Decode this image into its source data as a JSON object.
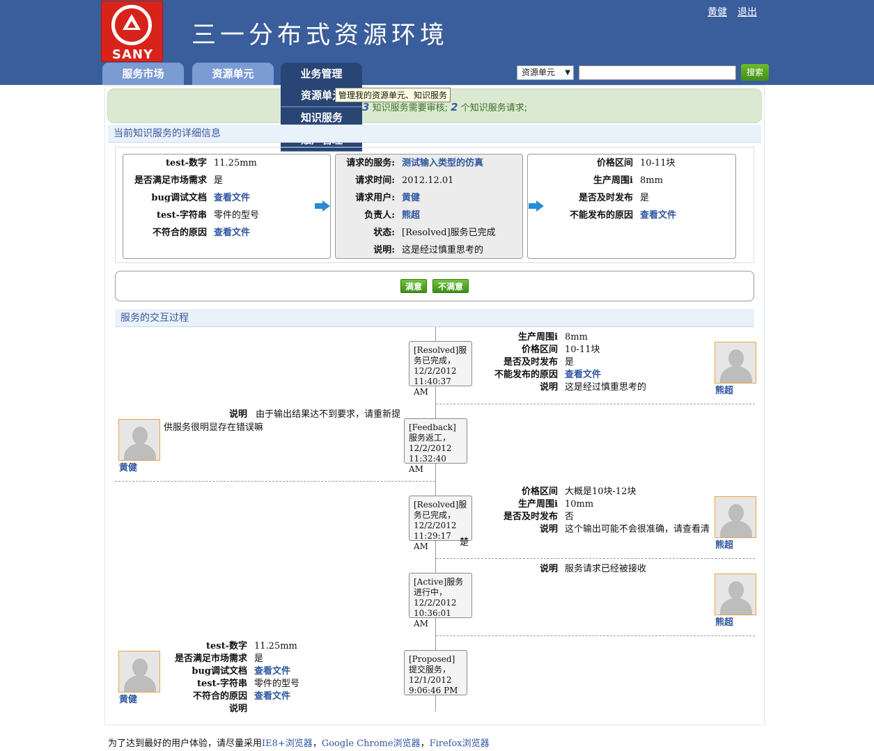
{
  "header": {
    "title": "三一分布式资源环境",
    "logo_text": "SANY",
    "user_link": "黄健",
    "logout_link": "退出"
  },
  "nav": {
    "tabs": [
      "服务市场",
      "资源单元",
      "业务管理"
    ],
    "dropdown": [
      "资源单元",
      "知识服务",
      "账户管理"
    ],
    "tooltip": "管理我的资源单元、知识服务"
  },
  "search": {
    "select_value": "资源单元",
    "input_value": "",
    "button": "搜索"
  },
  "notice": {
    "count1": "3",
    "text1": "知识服务需要审核;",
    "count2": "2",
    "text2": "个知识服务请求;"
  },
  "detail": {
    "section_title": "当前知识服务的详细信息",
    "left": [
      {
        "k": "test-数字",
        "v": "11.25mm"
      },
      {
        "k": "是否满足市场需求",
        "v": "是"
      },
      {
        "k": "bug调试文档",
        "v": "查看文件"
      },
      {
        "k": "test-字符串",
        "v": "零件的型号"
      },
      {
        "k": "不符合的原因",
        "v": "查看文件"
      }
    ],
    "middle": [
      {
        "k": "请求的服务:",
        "v": "测试输入类型的仿真"
      },
      {
        "k": "请求时间:",
        "v": "2012.12.01"
      },
      {
        "k": "请求用户:",
        "v": "黄健"
      },
      {
        "k": "负责人:",
        "v": "熊超"
      },
      {
        "k": "状态:",
        "v": "[Resolved]服务已完成"
      },
      {
        "k": "说明:",
        "v": "这是经过慎重思考的"
      }
    ],
    "right": [
      {
        "k": "价格区间",
        "v": "10-11块"
      },
      {
        "k": "生产周围i",
        "v": "8mm"
      },
      {
        "k": "是否及时发布",
        "v": "是"
      },
      {
        "k": "不能发布的原因",
        "v": "查看文件"
      }
    ]
  },
  "feedback": {
    "satisfied": "满意",
    "unsatisfied": "不满意"
  },
  "interaction": {
    "section_title": "服务的交互过程",
    "events": [
      {
        "status": "[Resolved]服务已完成，12/2/2012 11:40:37 AM",
        "user": "熊超",
        "fields": [
          {
            "k": "生产周围i",
            "v": "8mm"
          },
          {
            "k": "价格区间",
            "v": "10-11块"
          },
          {
            "k": "是否及时发布",
            "v": "是"
          },
          {
            "k": "不能发布的原因",
            "v": "查看文件"
          },
          {
            "k": "说明",
            "v": "这是经过慎重思考的"
          }
        ]
      },
      {
        "status": "[Feedback]服务返工，12/2/2012 11:32:40 AM",
        "user": "黄健",
        "fields": [
          {
            "k": "说明",
            "v": "由于输出结果达不到要求，请重新提供服务很明显存在错误嘛"
          }
        ]
      },
      {
        "status": "[Resolved]服务已完成，12/2/2012 11:29:17 AM",
        "user": "熊超",
        "fields": [
          {
            "k": "价格区间",
            "v": "大概是10块-12块"
          },
          {
            "k": "生产周围i",
            "v": "10mm"
          },
          {
            "k": "是否及时发布",
            "v": "否"
          },
          {
            "k": "说明",
            "v": "这个输出可能不会很准确，请查看清楚"
          }
        ]
      },
      {
        "status": "[Active]服务进行中，12/2/2012 10:36:01 AM",
        "user": "熊超",
        "fields": [
          {
            "k": "说明",
            "v": "服务请求已经被接收"
          }
        ]
      },
      {
        "status": "[Proposed]提交服务，12/1/2012 9:06:46 PM",
        "user": "黄健",
        "fields": [
          {
            "k": "test-数字",
            "v": "11.25mm"
          },
          {
            "k": "是否满足市场需求",
            "v": "是"
          },
          {
            "k": "bug调试文档",
            "v": "查看文件"
          },
          {
            "k": "test-字符串",
            "v": "零件的型号"
          },
          {
            "k": "不符合的原因",
            "v": "查看文件"
          },
          {
            "k": "说明",
            "v": ""
          }
        ]
      }
    ]
  },
  "footer": {
    "prefix": "为了达到最好的用户体验，请尽量采用",
    "ie": "IE8+浏览器",
    "sep1": "，",
    "chrome": "Google Chrome浏览器",
    "sep2": "，",
    "firefox": "Firefox浏览器"
  }
}
